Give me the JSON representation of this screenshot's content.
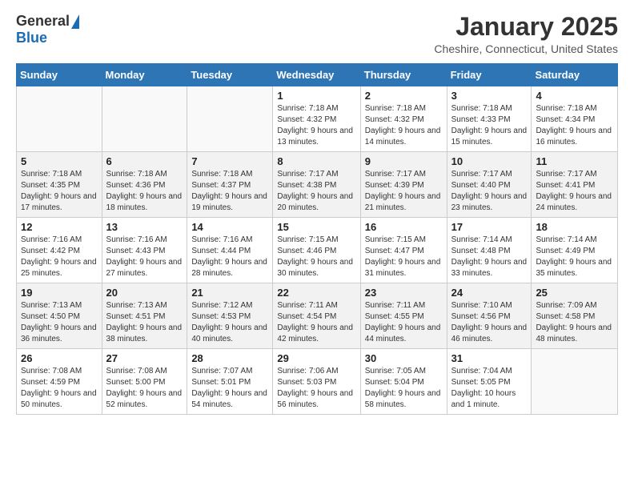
{
  "header": {
    "logo_general": "General",
    "logo_blue": "Blue",
    "month_title": "January 2025",
    "location": "Cheshire, Connecticut, United States"
  },
  "weekdays": [
    "Sunday",
    "Monday",
    "Tuesday",
    "Wednesday",
    "Thursday",
    "Friday",
    "Saturday"
  ],
  "weeks": [
    {
      "shaded": false,
      "days": [
        {
          "number": "",
          "sunrise": "",
          "sunset": "",
          "daylight": ""
        },
        {
          "number": "",
          "sunrise": "",
          "sunset": "",
          "daylight": ""
        },
        {
          "number": "",
          "sunrise": "",
          "sunset": "",
          "daylight": ""
        },
        {
          "number": "1",
          "sunrise": "Sunrise: 7:18 AM",
          "sunset": "Sunset: 4:32 PM",
          "daylight": "Daylight: 9 hours and 13 minutes."
        },
        {
          "number": "2",
          "sunrise": "Sunrise: 7:18 AM",
          "sunset": "Sunset: 4:32 PM",
          "daylight": "Daylight: 9 hours and 14 minutes."
        },
        {
          "number": "3",
          "sunrise": "Sunrise: 7:18 AM",
          "sunset": "Sunset: 4:33 PM",
          "daylight": "Daylight: 9 hours and 15 minutes."
        },
        {
          "number": "4",
          "sunrise": "Sunrise: 7:18 AM",
          "sunset": "Sunset: 4:34 PM",
          "daylight": "Daylight: 9 hours and 16 minutes."
        }
      ]
    },
    {
      "shaded": true,
      "days": [
        {
          "number": "5",
          "sunrise": "Sunrise: 7:18 AM",
          "sunset": "Sunset: 4:35 PM",
          "daylight": "Daylight: 9 hours and 17 minutes."
        },
        {
          "number": "6",
          "sunrise": "Sunrise: 7:18 AM",
          "sunset": "Sunset: 4:36 PM",
          "daylight": "Daylight: 9 hours and 18 minutes."
        },
        {
          "number": "7",
          "sunrise": "Sunrise: 7:18 AM",
          "sunset": "Sunset: 4:37 PM",
          "daylight": "Daylight: 9 hours and 19 minutes."
        },
        {
          "number": "8",
          "sunrise": "Sunrise: 7:17 AM",
          "sunset": "Sunset: 4:38 PM",
          "daylight": "Daylight: 9 hours and 20 minutes."
        },
        {
          "number": "9",
          "sunrise": "Sunrise: 7:17 AM",
          "sunset": "Sunset: 4:39 PM",
          "daylight": "Daylight: 9 hours and 21 minutes."
        },
        {
          "number": "10",
          "sunrise": "Sunrise: 7:17 AM",
          "sunset": "Sunset: 4:40 PM",
          "daylight": "Daylight: 9 hours and 23 minutes."
        },
        {
          "number": "11",
          "sunrise": "Sunrise: 7:17 AM",
          "sunset": "Sunset: 4:41 PM",
          "daylight": "Daylight: 9 hours and 24 minutes."
        }
      ]
    },
    {
      "shaded": false,
      "days": [
        {
          "number": "12",
          "sunrise": "Sunrise: 7:16 AM",
          "sunset": "Sunset: 4:42 PM",
          "daylight": "Daylight: 9 hours and 25 minutes."
        },
        {
          "number": "13",
          "sunrise": "Sunrise: 7:16 AM",
          "sunset": "Sunset: 4:43 PM",
          "daylight": "Daylight: 9 hours and 27 minutes."
        },
        {
          "number": "14",
          "sunrise": "Sunrise: 7:16 AM",
          "sunset": "Sunset: 4:44 PM",
          "daylight": "Daylight: 9 hours and 28 minutes."
        },
        {
          "number": "15",
          "sunrise": "Sunrise: 7:15 AM",
          "sunset": "Sunset: 4:46 PM",
          "daylight": "Daylight: 9 hours and 30 minutes."
        },
        {
          "number": "16",
          "sunrise": "Sunrise: 7:15 AM",
          "sunset": "Sunset: 4:47 PM",
          "daylight": "Daylight: 9 hours and 31 minutes."
        },
        {
          "number": "17",
          "sunrise": "Sunrise: 7:14 AM",
          "sunset": "Sunset: 4:48 PM",
          "daylight": "Daylight: 9 hours and 33 minutes."
        },
        {
          "number": "18",
          "sunrise": "Sunrise: 7:14 AM",
          "sunset": "Sunset: 4:49 PM",
          "daylight": "Daylight: 9 hours and 35 minutes."
        }
      ]
    },
    {
      "shaded": true,
      "days": [
        {
          "number": "19",
          "sunrise": "Sunrise: 7:13 AM",
          "sunset": "Sunset: 4:50 PM",
          "daylight": "Daylight: 9 hours and 36 minutes."
        },
        {
          "number": "20",
          "sunrise": "Sunrise: 7:13 AM",
          "sunset": "Sunset: 4:51 PM",
          "daylight": "Daylight: 9 hours and 38 minutes."
        },
        {
          "number": "21",
          "sunrise": "Sunrise: 7:12 AM",
          "sunset": "Sunset: 4:53 PM",
          "daylight": "Daylight: 9 hours and 40 minutes."
        },
        {
          "number": "22",
          "sunrise": "Sunrise: 7:11 AM",
          "sunset": "Sunset: 4:54 PM",
          "daylight": "Daylight: 9 hours and 42 minutes."
        },
        {
          "number": "23",
          "sunrise": "Sunrise: 7:11 AM",
          "sunset": "Sunset: 4:55 PM",
          "daylight": "Daylight: 9 hours and 44 minutes."
        },
        {
          "number": "24",
          "sunrise": "Sunrise: 7:10 AM",
          "sunset": "Sunset: 4:56 PM",
          "daylight": "Daylight: 9 hours and 46 minutes."
        },
        {
          "number": "25",
          "sunrise": "Sunrise: 7:09 AM",
          "sunset": "Sunset: 4:58 PM",
          "daylight": "Daylight: 9 hours and 48 minutes."
        }
      ]
    },
    {
      "shaded": false,
      "days": [
        {
          "number": "26",
          "sunrise": "Sunrise: 7:08 AM",
          "sunset": "Sunset: 4:59 PM",
          "daylight": "Daylight: 9 hours and 50 minutes."
        },
        {
          "number": "27",
          "sunrise": "Sunrise: 7:08 AM",
          "sunset": "Sunset: 5:00 PM",
          "daylight": "Daylight: 9 hours and 52 minutes."
        },
        {
          "number": "28",
          "sunrise": "Sunrise: 7:07 AM",
          "sunset": "Sunset: 5:01 PM",
          "daylight": "Daylight: 9 hours and 54 minutes."
        },
        {
          "number": "29",
          "sunrise": "Sunrise: 7:06 AM",
          "sunset": "Sunset: 5:03 PM",
          "daylight": "Daylight: 9 hours and 56 minutes."
        },
        {
          "number": "30",
          "sunrise": "Sunrise: 7:05 AM",
          "sunset": "Sunset: 5:04 PM",
          "daylight": "Daylight: 9 hours and 58 minutes."
        },
        {
          "number": "31",
          "sunrise": "Sunrise: 7:04 AM",
          "sunset": "Sunset: 5:05 PM",
          "daylight": "Daylight: 10 hours and 1 minute."
        },
        {
          "number": "",
          "sunrise": "",
          "sunset": "",
          "daylight": ""
        }
      ]
    }
  ]
}
